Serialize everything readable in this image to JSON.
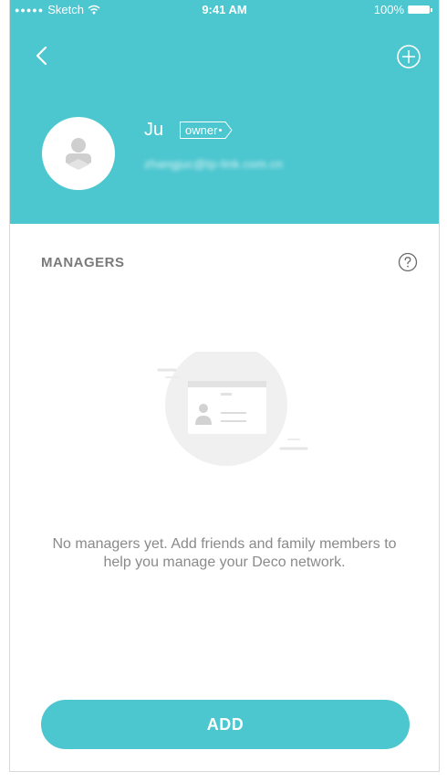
{
  "status_bar": {
    "carrier": "Sketch",
    "time": "9:41 AM",
    "battery": "100%"
  },
  "header": {
    "user_name": "Ju",
    "role_label": "owner",
    "email": "zhangjuc@tp-link.com.cn"
  },
  "managers": {
    "section_title": "MANAGERS",
    "empty_message": "No managers yet. Add friends and family members to help you manage your Deco network."
  },
  "add_button": {
    "label": "ADD"
  },
  "colors": {
    "accent": "#4cc6cf",
    "muted_text": "#8a8a8a"
  },
  "icons": {
    "back": "chevron-left-icon",
    "add": "plus-circle-icon",
    "help": "question-circle-icon",
    "avatar": "user-avatar-icon",
    "illustration": "id-card-icon"
  }
}
